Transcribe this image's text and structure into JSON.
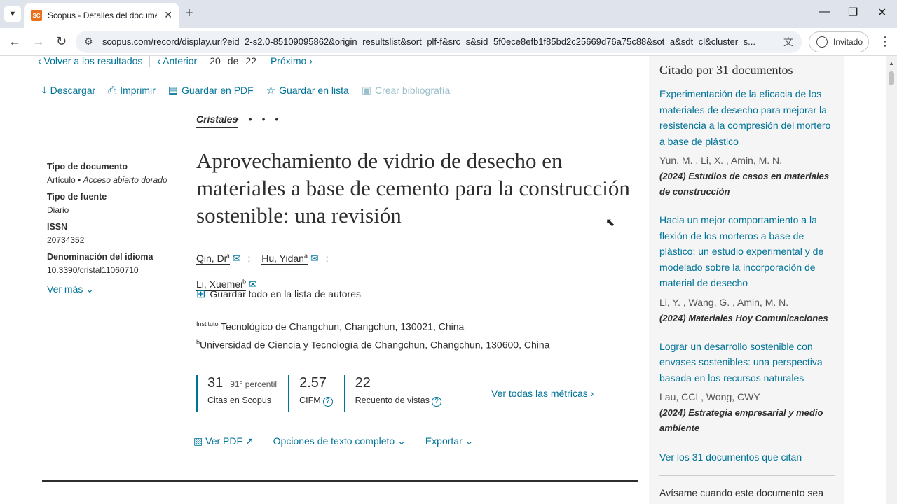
{
  "browser": {
    "tab_title": "Scopus - Detalles del documento",
    "favicon_text": "SC",
    "url": "scopus.com/record/display.uri?eid=2-s2.0-85109095862&origin=resultslist&sort=plf-f&src=s&sid=5f0ece8efb1f85bd2c25669d76a75c88&sot=a&sdt=cl&cluster=s...",
    "profile_label": "Invitado"
  },
  "nav": {
    "back_results": "‹ Volver a los resultados",
    "prev": "‹ Anterior",
    "current": "20",
    "of": "de",
    "total": "22",
    "next": "Próximo ›"
  },
  "toolbar": {
    "download": "Descargar",
    "print": "Imprimir",
    "save_pdf": "Guardar en PDF",
    "save_list": "Guardar en lista",
    "bibliography": "Crear bibliografía"
  },
  "journal": "Cristales",
  "journal_dots": "• • • •",
  "meta": {
    "doc_type_label": "Tipo de documento",
    "doc_type_value": "Artículo",
    "access": "Acceso abierto dorado",
    "source_type_label": "Tipo de fuente",
    "source_type_value": "Diario",
    "issn_label": "ISSN",
    "issn_value": "20734352",
    "lang_label": "Denominación del idioma",
    "lang_value": "10.3390/cristal11060710",
    "see_more": "Ver más"
  },
  "title": "Aprovechamiento de vidrio de desecho en materiales a base de cemento para la construcción sostenible: una revisión",
  "authors": [
    {
      "name": "Qin, Di",
      "sup": "a"
    },
    {
      "name": "Hu, Yidan",
      "sup": "a"
    },
    {
      "name": "Li, Xuemei",
      "sup": "b"
    }
  ],
  "author_sep": ";",
  "save_all_authors": "Guardar todo en la lista de autores",
  "affiliations": [
    {
      "sup": "Instituto",
      "text": "Tecnológico de Changchun, Changchun, 130021, China"
    },
    {
      "sup": "b",
      "text": "Universidad de Ciencia y Tecnología de Changchun, Changchun, 130600, China"
    }
  ],
  "metrics": {
    "citations_value": "31",
    "citations_percentile": "91° percentil",
    "citations_label": "Citas en Scopus",
    "fwci_value": "2.57",
    "fwci_label": "CIFM",
    "views_value": "22",
    "views_label": "Recuento de vistas",
    "all_metrics": "Ver todas las métricas"
  },
  "actions": {
    "view_pdf": "Ver PDF",
    "full_text": "Opciones de texto completo",
    "export": "Exportar"
  },
  "sidebar": {
    "heading": "Citado por 31 documentos",
    "citations": [
      {
        "title": "Experimentación de la eficacia de los materiales de desecho para mejorar la resistencia a la compresión del mortero a base de plástico",
        "authors": "Yun, M. , Li, X. , Amin, M. N.",
        "source": "(2024) Estudios de casos en materiales de construcción"
      },
      {
        "title": "Hacia un mejor comportamiento a la flexión de los morteros a base de plástico: un estudio experimental y de modelado sobre la incorporación de material de desecho",
        "authors": "Li, Y. , Wang, G. , Amin, M. N.",
        "source": "(2024) Materiales Hoy Comunicaciones"
      },
      {
        "title": "Lograr un desarrollo sostenible con envases sostenibles: una perspectiva basada en los recursos naturales",
        "authors": "Lau, CCI , Wong, CWY",
        "source": "(2024) Estrategia empresarial y medio ambiente"
      }
    ],
    "see_all": "Ver los 31 documentos que citan",
    "alert": "Avísame cuando este documento sea"
  }
}
